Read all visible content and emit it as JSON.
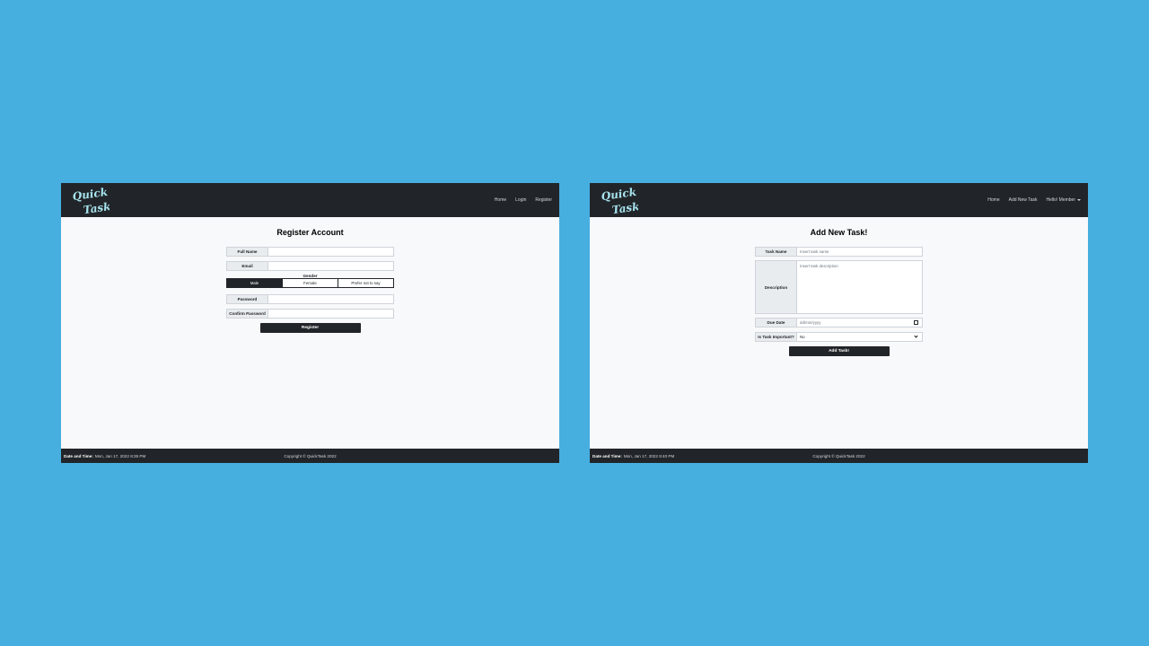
{
  "register_screen": {
    "logo": {
      "line1": "Quick",
      "line2": "Task"
    },
    "nav": [
      "Home",
      "Login",
      "Register"
    ],
    "title": "Register Account",
    "fields": {
      "full_name": {
        "label": "Full Name",
        "value": ""
      },
      "email": {
        "label": "Email",
        "value": ""
      },
      "password": {
        "label": "Password",
        "value": ""
      },
      "confirm_password": {
        "label": "Confirm Password",
        "value": ""
      }
    },
    "gender": {
      "label": "Gender",
      "options": [
        "Male",
        "Female",
        "Prefer not to say"
      ],
      "selected": "Male"
    },
    "submit_label": "Register",
    "footer": {
      "datetime_label": "Date and Time:",
      "datetime_value": "Mon, Jan 17, 2022 8:35 PM",
      "copyright": "Copyright © QuickTask 2022"
    }
  },
  "add_task_screen": {
    "logo": {
      "line1": "Quick",
      "line2": "Task"
    },
    "nav": [
      "Home",
      "Add New Task",
      "Hello! Member"
    ],
    "title": "Add New Task!",
    "fields": {
      "task_name": {
        "label": "Task Name",
        "placeholder": "Insert task name"
      },
      "description": {
        "label": "Description",
        "placeholder": "Insert task description"
      },
      "due_date": {
        "label": "Due Date",
        "placeholder": "dd/mm/yyyy"
      },
      "important": {
        "label": "Is Task Important?",
        "value": "No"
      }
    },
    "submit_label": "Add Task!",
    "footer": {
      "datetime_label": "Date and Time:",
      "datetime_value": "Mon, Jan 17, 2022 8:40 PM",
      "copyright": "Copyright © QuickTask 2022"
    }
  },
  "colors": {
    "background": "#47aee0",
    "navbar": "#212529",
    "logo_text": "#a8e4ef",
    "page": "#f8f9fa"
  }
}
